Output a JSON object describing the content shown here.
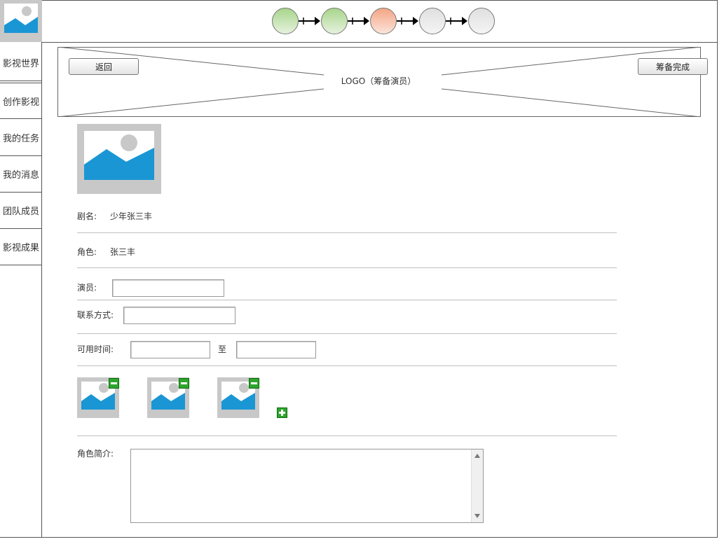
{
  "nav": {
    "items": [
      {
        "label": "影视世界"
      },
      {
        "label": "创作影视"
      },
      {
        "label": "我的任务"
      },
      {
        "label": "我的消息"
      },
      {
        "label": "团队成员"
      },
      {
        "label": "影视成果"
      }
    ]
  },
  "progress": {
    "steps": [
      {
        "state": "done"
      },
      {
        "state": "done"
      },
      {
        "state": "current"
      },
      {
        "state": "todo"
      },
      {
        "state": "todo"
      }
    ]
  },
  "header": {
    "back_label": "返回",
    "done_label": "筹备完成",
    "logo_text": "LOGO（筹备演员）"
  },
  "form": {
    "drama_label": "剧名:",
    "drama_value": "少年张三丰",
    "role_label": "角色:",
    "role_value": "张三丰",
    "actor_label": "演员:",
    "actor_value": "",
    "contact_label": "联系方式:",
    "contact_value": "",
    "time_label": "可用时间:",
    "time_to": "至",
    "time_from_value": "",
    "time_to_value": "",
    "intro_label": "角色简介:",
    "intro_value": ""
  },
  "colors": {
    "image_blue": "#1a96d4",
    "placeholder_gray": "#c8c8c8",
    "step_done": "#a8d58b",
    "step_current": "#f4a585",
    "step_todo": "#e0e0e0",
    "add_remove_green": "#2da62d"
  }
}
